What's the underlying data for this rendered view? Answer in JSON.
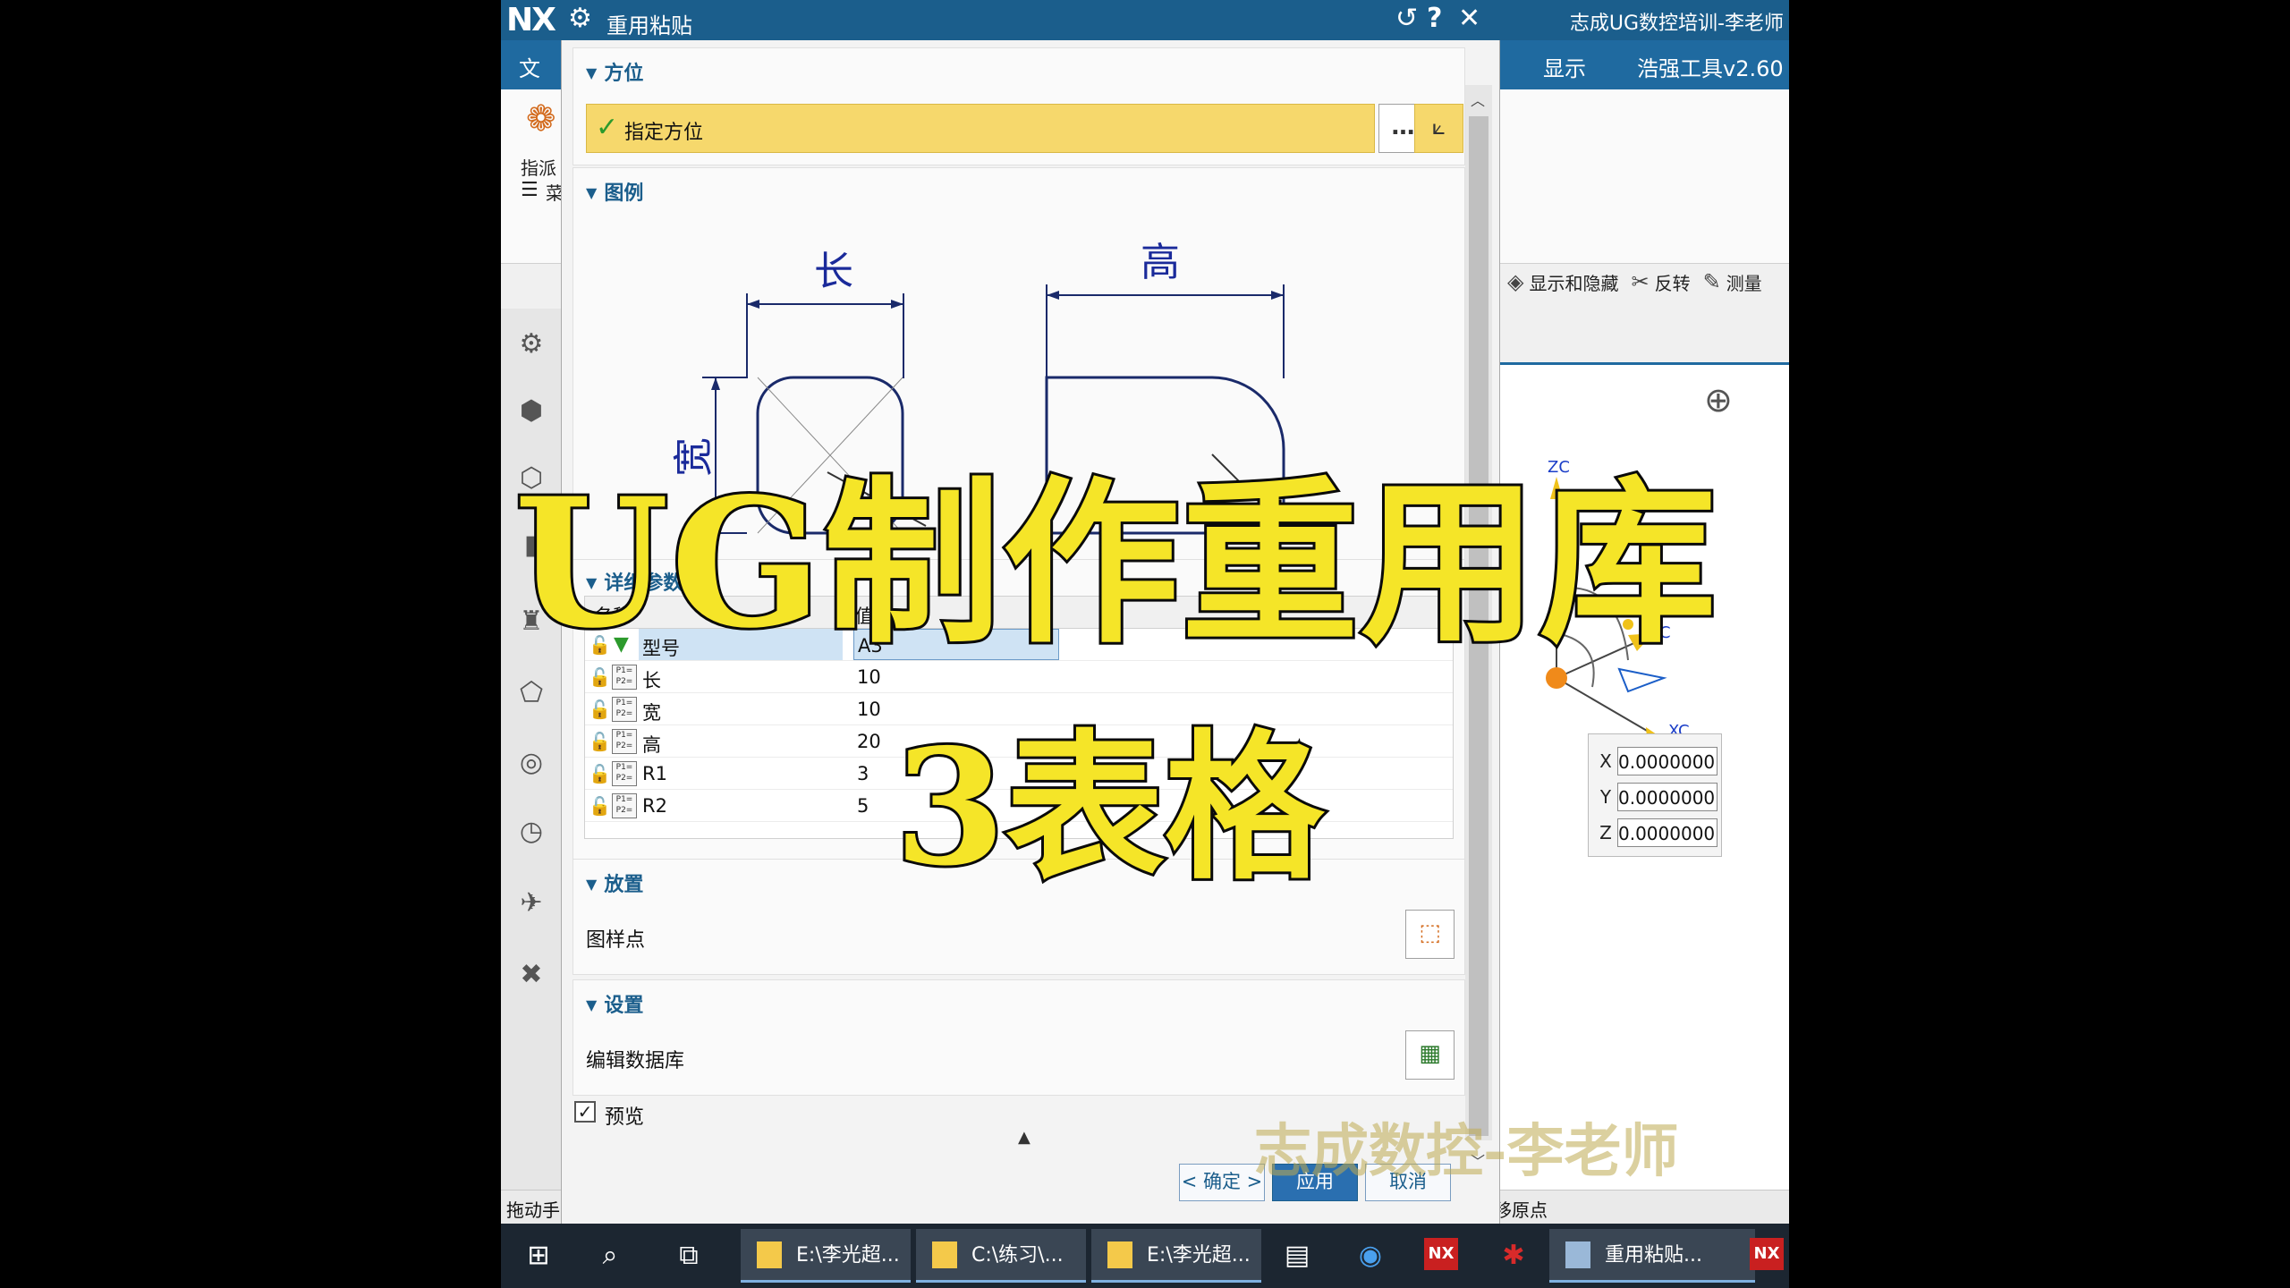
{
  "app": {
    "logo": "NX",
    "main_title": "志成UG数控培训-李老师",
    "ribbon_tabs": [
      "文",
      "显示",
      "浩强工具v2.60"
    ],
    "ribbon_label": "指派",
    "menu_label": "菜",
    "toolbar_items": [
      "显示和隐藏",
      "反转",
      "测量"
    ],
    "status_left": "拖动手",
    "status_right": "移原点"
  },
  "dialog": {
    "title": "重用粘贴",
    "sections": {
      "orientation": {
        "header": "方位",
        "row_label": "指定方位",
        "more_btn": "…"
      },
      "legend": {
        "header": "图例",
        "labels": {
          "length": "长",
          "width": "宽",
          "height": "高"
        }
      },
      "params": {
        "header": "详细参数",
        "col_name": "名称",
        "col_value": "值",
        "rows": [
          {
            "name": "型号",
            "value": "A3"
          },
          {
            "name": "长",
            "value": "10"
          },
          {
            "name": "宽",
            "value": "10"
          },
          {
            "name": "高",
            "value": "20"
          },
          {
            "name": "R1",
            "value": "3"
          },
          {
            "name": "R2",
            "value": "5"
          }
        ]
      },
      "placement": {
        "header": "放置",
        "row_label": "图样点"
      },
      "settings": {
        "header": "设置",
        "row_label": "编辑数据库"
      }
    },
    "preview_label": "预览",
    "buttons": {
      "ok": "< 确定 >",
      "apply": "应用",
      "cancel": "取消"
    }
  },
  "coords": {
    "x_label": "X",
    "x_value": "0.0000000",
    "y_label": "Y",
    "y_value": "0.0000000",
    "z_label": "Z",
    "z_value": "0.0000000"
  },
  "axes": {
    "x": "XC",
    "y": "YC",
    "z": "ZC"
  },
  "taskbar": {
    "apps": [
      "E:\\李光超...",
      "C:\\练习\\...",
      "E:\\李光超...",
      "重用粘贴..."
    ],
    "nx_badge": "NX"
  },
  "overlay": {
    "title": "UG制作重用库",
    "subtitle": "3表格",
    "watermark": "志成数控-李老师"
  },
  "colors": {
    "title_bar": "#1b5e8c",
    "highlight": "#f6d86c",
    "overlay_text": "#f5e528",
    "section_header": "#1b5e8c"
  }
}
